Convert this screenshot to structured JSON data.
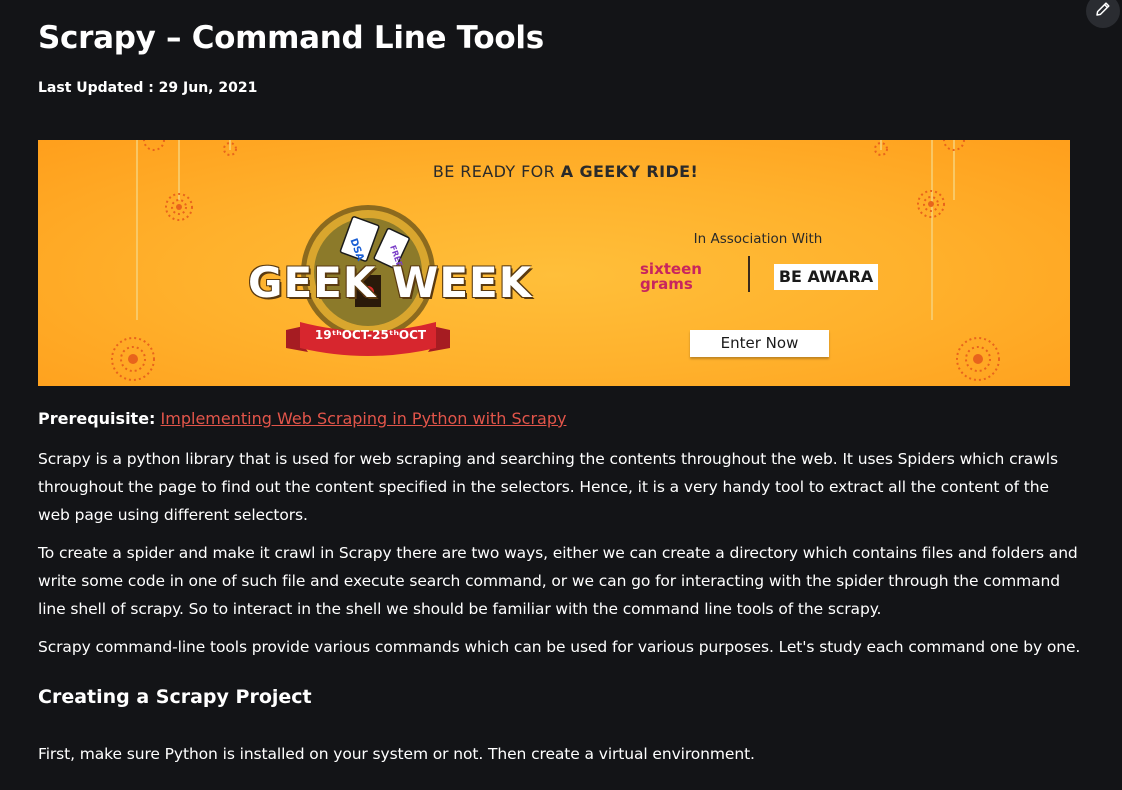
{
  "article": {
    "title": "Scrapy – Command Line Tools",
    "last_updated": "Last Updated : 29 Jun, 2021"
  },
  "banner": {
    "headline_prefix": "BE READY FOR ",
    "headline_bold": "A GEEKY RIDE!",
    "event_name": "GEEK WEEK",
    "dates": "19ᵗʰOCT-25ᵗʰOCT",
    "ticket_labels": [
      "DSA",
      "FREE"
    ],
    "association_text": "In Association With",
    "sponsor_1": "sixteen grams",
    "sponsor_2": "BE AWARA",
    "cta_label": "Enter Now",
    "colors": {
      "background": "#ffb12c",
      "brand_red": "#d7262e",
      "sponsor_pink": "#c8255e"
    }
  },
  "prerequisite": {
    "label": "Prerequisite:",
    "link_text": "Implementing Web Scraping in Python with Scrapy",
    "link_color": "#e2554a"
  },
  "paragraphs": [
    "Scrapy is a python library that is used for web scraping and searching the contents throughout the web. It uses Spiders which crawls throughout the page to find out the content specified in the selectors. Hence, it is a very handy tool to extract all the content of the web page using different selectors.",
    "To create a spider and make it crawl in Scrapy there are two ways, either we can create a directory which contains files and folders and write some code in one of such file and execute search command, or we can go for interacting with the spider through the command line shell of scrapy. So to interact in the shell we should be familiar with the command line tools of the scrapy.",
    "Scrapy command-line tools provide various commands which can be used for various purposes. Let's study each command one by one."
  ],
  "section": {
    "heading": "Creating a Scrapy Project",
    "paragraph": "First, make sure Python is installed on your system or not. Then create a virtual environment."
  },
  "toolbar": {
    "edit_icon": "pencil-icon"
  }
}
